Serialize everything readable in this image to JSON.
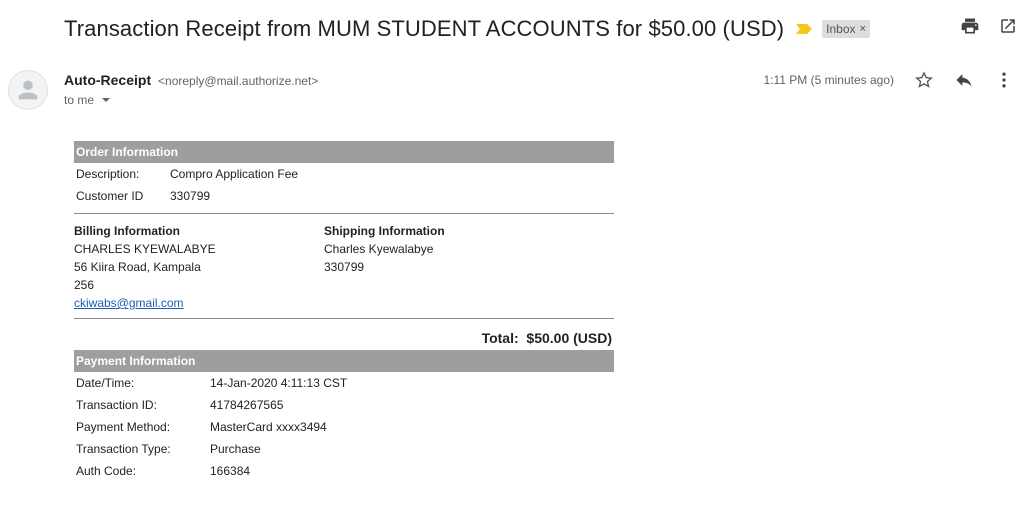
{
  "header": {
    "subject": "Transaction Receipt from MUM STUDENT ACCOUNTS for $50.00 (USD)",
    "label": "Inbox",
    "label_close": "×",
    "icons": [
      "print-icon",
      "open-in-new-window-icon"
    ]
  },
  "message": {
    "sender_name": "Auto-Receipt",
    "sender_email": "<noreply@mail.authorize.net>",
    "to": "to me",
    "time": "1:11 PM (5 minutes ago)",
    "icons": [
      "star-icon",
      "reply-icon",
      "more-vert-icon"
    ]
  },
  "receipt": {
    "order_heading": "Order Information",
    "order_rows": [
      {
        "k": "Description:",
        "v": "Compro Application Fee"
      },
      {
        "k": "Customer ID",
        "v": "330799"
      }
    ],
    "billing": {
      "title": "Billing Information",
      "name": "CHARLES KYEWALABYE",
      "address": "56 Kiira Road, Kampala",
      "zip": "256",
      "email": "ckiwabs@gmail.com"
    },
    "shipping": {
      "title": "Shipping Information",
      "name": "Charles Kyewalabye",
      "id": "330799"
    },
    "total": "Total:  $50.00 (USD)",
    "payment_heading": "Payment Information",
    "payment_rows": [
      {
        "k": "Date/Time:",
        "v": "14-Jan-2020 4:11:13 CST"
      },
      {
        "k": "Transaction ID:",
        "v": "41784267565"
      },
      {
        "k": "Payment Method:",
        "v": "MasterCard xxxx3494"
      },
      {
        "k": "Transaction Type:",
        "v": "Purchase"
      },
      {
        "k": "Auth Code:",
        "v": "166384"
      }
    ]
  },
  "colors": {
    "section_header_bg": "#9e9e9e",
    "importance_marker": "#f5c518",
    "link": "#1a5fb4"
  }
}
